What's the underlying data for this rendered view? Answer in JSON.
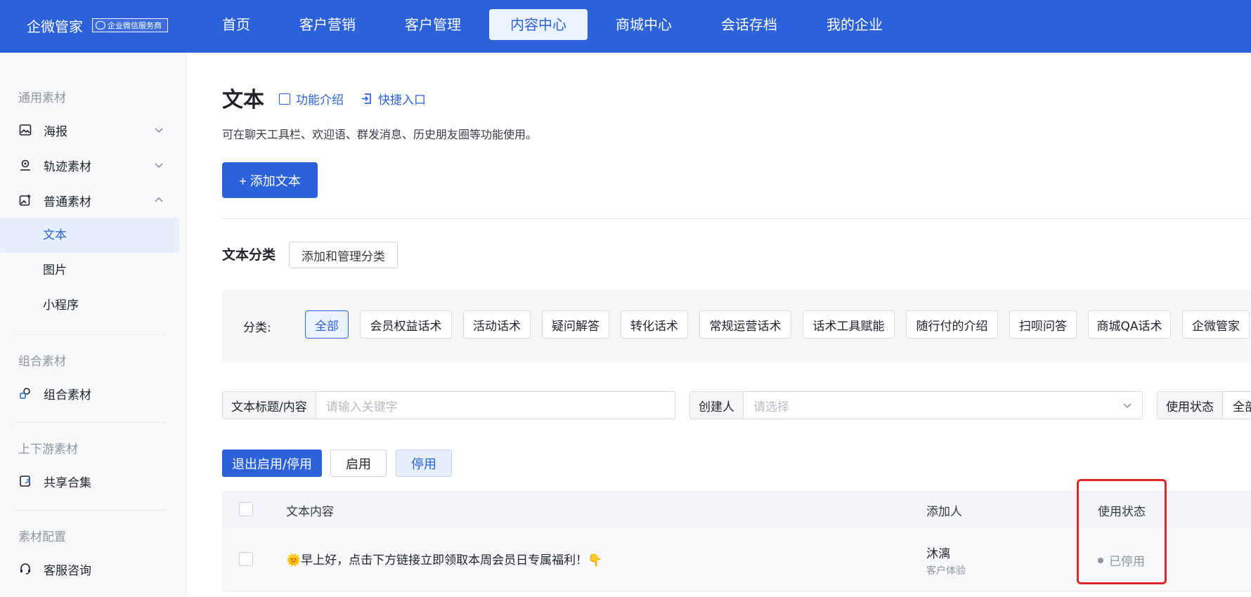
{
  "topbar": {
    "brand": "企微管家",
    "badge": "企业微信服务商",
    "nav": [
      "首页",
      "客户营销",
      "客户管理",
      "内容中心",
      "商城中心",
      "会话存档",
      "我的企业"
    ],
    "active_nav": "内容中心"
  },
  "sidebar": {
    "groups": {
      "general": "通用素材",
      "combo": "组合素材",
      "updown": "上下游素材",
      "config": "素材配置"
    },
    "items": {
      "poster": "海报",
      "track": "轨迹素材",
      "normal": "普通素材",
      "text": "文本",
      "image": "图片",
      "miniprogram": "小程序",
      "combo_item": "组合素材",
      "shared": "共享合集",
      "service": "客服咨询"
    }
  },
  "main": {
    "title": "文本",
    "intro_link": "功能介绍",
    "shortcut_link": "快捷入口",
    "description": "可在聊天工具栏、欢迎语、群发消息、历史朋友圈等功能使用。",
    "add_button": "+ 添加文本",
    "category_heading": "文本分类",
    "category_manage": "添加和管理分类",
    "category_label": "分类:",
    "categories": [
      "全部",
      "会员权益话术",
      "活动话术",
      "疑问解答",
      "转化话术",
      "常规运营话术",
      "话术工具赋能",
      "随行付的介绍",
      "扫呗问答",
      "商城QA话术",
      "企微管家"
    ],
    "active_category": "全部",
    "filters": {
      "title_label": "文本标题/内容",
      "title_placeholder": "请输入关键字",
      "creator_label": "创建人",
      "creator_placeholder": "请选择",
      "status_label": "使用状态",
      "status_value": "全部"
    },
    "actions": {
      "exit": "退出启用/停用",
      "enable": "启用",
      "disable": "停用"
    },
    "table": {
      "headers": {
        "content": "文本内容",
        "adder": "添加人",
        "status": "使用状态"
      },
      "rows": [
        {
          "content": "🌞早上好，点击下方链接立即领取本周会员日专属福利！👇",
          "adder": "沐漓",
          "adder_dept": "客户体验",
          "status": "已停用"
        }
      ]
    }
  },
  "colors": {
    "primary": "#2b61d9",
    "highlight": "#e5252a"
  }
}
